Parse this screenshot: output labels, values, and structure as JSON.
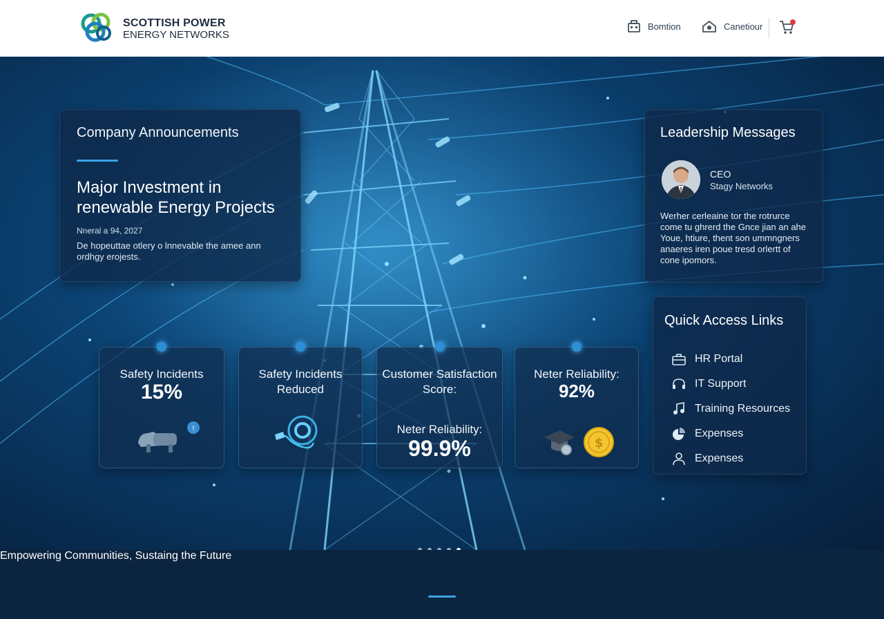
{
  "header": {
    "brand_line1": "SCOTTISH POWER",
    "brand_line2": "ENERGY NETWORKS",
    "nav": [
      {
        "label": "Bomtion",
        "icon": "toolbox-icon"
      },
      {
        "label": "Canetiour",
        "icon": "home-icon"
      }
    ],
    "cart_icon": "cart-icon"
  },
  "announcements": {
    "title": "Company Announcements",
    "headline": "Major Investment in renewable Energy Projects",
    "date": "Nneral a 94, 2027",
    "description": "De hopeuttae otlery o lnnevable the amee ann ordhgy erojests."
  },
  "leadership": {
    "title": "Leadership Messages",
    "role": "CEO",
    "org": "Stagy Networks",
    "message": "Werher cerleaine tor the rotrurce come tu ghrerd the Gnce jian an ahe Youe, htiure, thent son ummngners anaeres iren poue tresd orlertt of cone ipomors."
  },
  "quick_links": {
    "title": "Quick Access Links",
    "items": [
      {
        "label": "HR Portal",
        "icon": "briefcase-icon"
      },
      {
        "label": "IT Support",
        "icon": "headset-icon"
      },
      {
        "label": "Training Resources",
        "icon": "music-note-icon"
      },
      {
        "label": "Expenses",
        "icon": "chart-pie-icon"
      },
      {
        "label": "Expenses",
        "icon": "user-icon"
      }
    ]
  },
  "stats": [
    {
      "label": "Safety Incidents",
      "value": "15%"
    },
    {
      "label": "Safety Incidents Reduced",
      "value": ""
    },
    {
      "label": "Customer Satisfaction Score:",
      "sublabel": "Neter Reliability:",
      "value": "99.9%"
    },
    {
      "label": "Neter Reliability:",
      "value": "92%"
    }
  ],
  "carousel": {
    "count": 5,
    "active": 4
  },
  "footer": {
    "tagline": "Empowering Communities, Sustaing the Future"
  },
  "colors": {
    "accent": "#3aa5e6",
    "header_bg": "#ffffff",
    "hero_dark": "#082a4d",
    "footer_bg": "#0b2440"
  }
}
